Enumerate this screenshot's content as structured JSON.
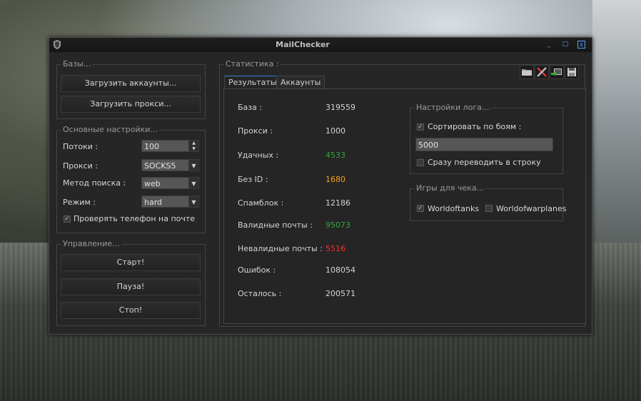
{
  "window": {
    "title": "MailChecker",
    "minimize": "_",
    "maximize": "□",
    "close": "x"
  },
  "bases": {
    "title": "Базы...",
    "load_accounts": "Загрузить аккаунты...",
    "load_proxy": "Загрузить прокси..."
  },
  "settings": {
    "title": "Основные настройки...",
    "threads_label": "Потоки :",
    "threads_value": "100",
    "proxy_label": "Прокси :",
    "proxy_value": "SOCKS5",
    "search_label": "Метод поиска :",
    "search_value": "web",
    "mode_label": "Режим  :",
    "mode_value": "hard",
    "check_phone_label": "Проверять телефон на почте",
    "check_phone_checked": true
  },
  "control": {
    "title": "Управление...",
    "start": "Старт!",
    "pause": "Пауза!",
    "stop": "Стоп!"
  },
  "stats": {
    "title": "Статистика :",
    "tabs": [
      "Результаты",
      "Аккаунты"
    ],
    "active_tab": 0,
    "rows": [
      {
        "label": "База :",
        "value": "319559",
        "color": "#d4d4d4"
      },
      {
        "label": "Прокси :",
        "value": "1000",
        "color": "#d4d4d4"
      },
      {
        "label": "Удачных :",
        "value": "4533",
        "color": "#2fa83a"
      },
      {
        "label": "Без ID :",
        "value": "1680",
        "color": "#ff9d1f"
      },
      {
        "label": "Спамблок :",
        "value": "12186",
        "color": "#d4d4d4"
      },
      {
        "label": "Валидные почты :",
        "value": "95073",
        "color": "#2fa83a"
      },
      {
        "label": "Невалидные почты :",
        "value": "5516",
        "color": "#ff2a2a"
      },
      {
        "label": "Ошибок :",
        "value": "108054",
        "color": "#d4d4d4"
      },
      {
        "label": "Осталось :",
        "value": "200571",
        "color": "#d4d4d4"
      }
    ]
  },
  "log_settings": {
    "title": "Настройки лога...",
    "sort_label": "Сортировать по боям :",
    "sort_checked": true,
    "sort_value": "5000",
    "inline_label": "Сразу переводить в строку",
    "inline_checked": false
  },
  "games": {
    "title": "Игры для чека...",
    "items": [
      {
        "label": "Worldoftanks",
        "checked": true
      },
      {
        "label": "Worldofwarplanes",
        "checked": false
      }
    ]
  },
  "toolbar": {
    "icons": [
      "folder-icon",
      "tools-icon",
      "export-icon",
      "save-icon"
    ]
  }
}
